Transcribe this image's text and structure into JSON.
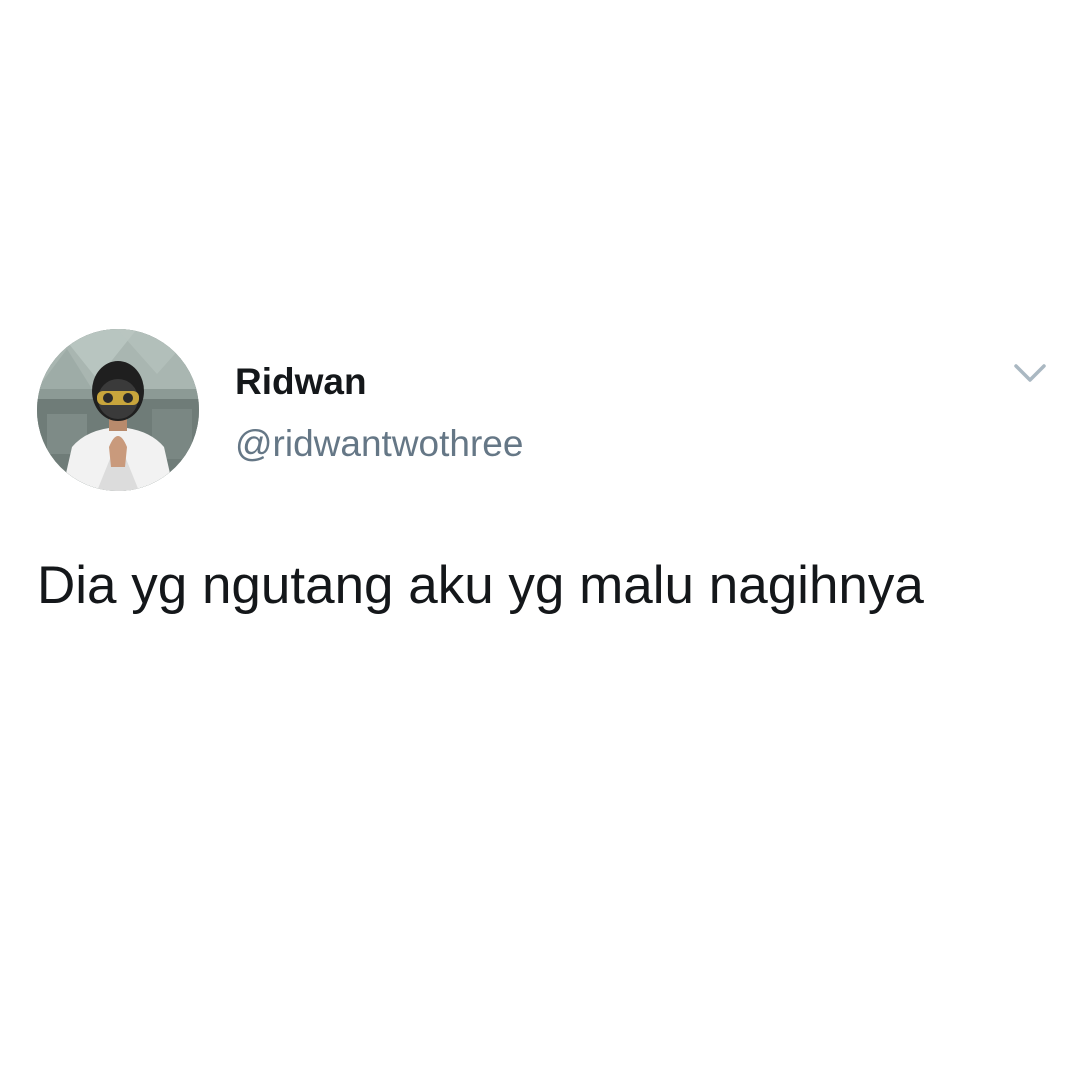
{
  "tweet": {
    "author": {
      "display_name": "Ridwan",
      "handle": "@ridwantwothree"
    },
    "text": "Dia yg ngutang aku yg malu nagihnya",
    "menu_icon": "chevron-down-icon"
  },
  "colors": {
    "background": "#ffffff",
    "name": "#14171a",
    "handle": "#657786",
    "text": "#14171a",
    "chevron": "#aab8c2"
  }
}
